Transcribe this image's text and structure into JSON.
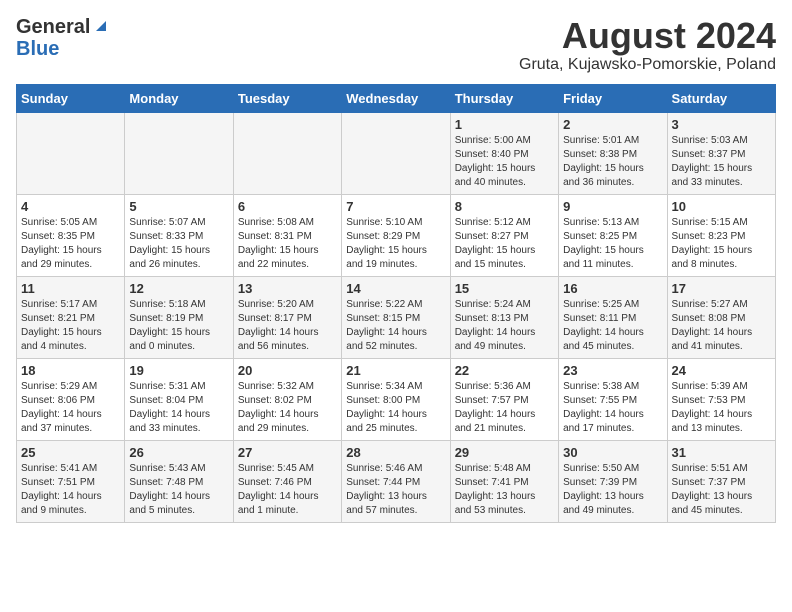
{
  "logo": {
    "line1": "General",
    "line2": "Blue"
  },
  "title": "August 2024",
  "subtitle": "Gruta, Kujawsko-Pomorskie, Poland",
  "headers": [
    "Sunday",
    "Monday",
    "Tuesday",
    "Wednesday",
    "Thursday",
    "Friday",
    "Saturday"
  ],
  "weeks": [
    [
      {
        "day": "",
        "info": ""
      },
      {
        "day": "",
        "info": ""
      },
      {
        "day": "",
        "info": ""
      },
      {
        "day": "",
        "info": ""
      },
      {
        "day": "1",
        "info": "Sunrise: 5:00 AM\nSunset: 8:40 PM\nDaylight: 15 hours\nand 40 minutes."
      },
      {
        "day": "2",
        "info": "Sunrise: 5:01 AM\nSunset: 8:38 PM\nDaylight: 15 hours\nand 36 minutes."
      },
      {
        "day": "3",
        "info": "Sunrise: 5:03 AM\nSunset: 8:37 PM\nDaylight: 15 hours\nand 33 minutes."
      }
    ],
    [
      {
        "day": "4",
        "info": "Sunrise: 5:05 AM\nSunset: 8:35 PM\nDaylight: 15 hours\nand 29 minutes."
      },
      {
        "day": "5",
        "info": "Sunrise: 5:07 AM\nSunset: 8:33 PM\nDaylight: 15 hours\nand 26 minutes."
      },
      {
        "day": "6",
        "info": "Sunrise: 5:08 AM\nSunset: 8:31 PM\nDaylight: 15 hours\nand 22 minutes."
      },
      {
        "day": "7",
        "info": "Sunrise: 5:10 AM\nSunset: 8:29 PM\nDaylight: 15 hours\nand 19 minutes."
      },
      {
        "day": "8",
        "info": "Sunrise: 5:12 AM\nSunset: 8:27 PM\nDaylight: 15 hours\nand 15 minutes."
      },
      {
        "day": "9",
        "info": "Sunrise: 5:13 AM\nSunset: 8:25 PM\nDaylight: 15 hours\nand 11 minutes."
      },
      {
        "day": "10",
        "info": "Sunrise: 5:15 AM\nSunset: 8:23 PM\nDaylight: 15 hours\nand 8 minutes."
      }
    ],
    [
      {
        "day": "11",
        "info": "Sunrise: 5:17 AM\nSunset: 8:21 PM\nDaylight: 15 hours\nand 4 minutes."
      },
      {
        "day": "12",
        "info": "Sunrise: 5:18 AM\nSunset: 8:19 PM\nDaylight: 15 hours\nand 0 minutes."
      },
      {
        "day": "13",
        "info": "Sunrise: 5:20 AM\nSunset: 8:17 PM\nDaylight: 14 hours\nand 56 minutes."
      },
      {
        "day": "14",
        "info": "Sunrise: 5:22 AM\nSunset: 8:15 PM\nDaylight: 14 hours\nand 52 minutes."
      },
      {
        "day": "15",
        "info": "Sunrise: 5:24 AM\nSunset: 8:13 PM\nDaylight: 14 hours\nand 49 minutes."
      },
      {
        "day": "16",
        "info": "Sunrise: 5:25 AM\nSunset: 8:11 PM\nDaylight: 14 hours\nand 45 minutes."
      },
      {
        "day": "17",
        "info": "Sunrise: 5:27 AM\nSunset: 8:08 PM\nDaylight: 14 hours\nand 41 minutes."
      }
    ],
    [
      {
        "day": "18",
        "info": "Sunrise: 5:29 AM\nSunset: 8:06 PM\nDaylight: 14 hours\nand 37 minutes."
      },
      {
        "day": "19",
        "info": "Sunrise: 5:31 AM\nSunset: 8:04 PM\nDaylight: 14 hours\nand 33 minutes."
      },
      {
        "day": "20",
        "info": "Sunrise: 5:32 AM\nSunset: 8:02 PM\nDaylight: 14 hours\nand 29 minutes."
      },
      {
        "day": "21",
        "info": "Sunrise: 5:34 AM\nSunset: 8:00 PM\nDaylight: 14 hours\nand 25 minutes."
      },
      {
        "day": "22",
        "info": "Sunrise: 5:36 AM\nSunset: 7:57 PM\nDaylight: 14 hours\nand 21 minutes."
      },
      {
        "day": "23",
        "info": "Sunrise: 5:38 AM\nSunset: 7:55 PM\nDaylight: 14 hours\nand 17 minutes."
      },
      {
        "day": "24",
        "info": "Sunrise: 5:39 AM\nSunset: 7:53 PM\nDaylight: 14 hours\nand 13 minutes."
      }
    ],
    [
      {
        "day": "25",
        "info": "Sunrise: 5:41 AM\nSunset: 7:51 PM\nDaylight: 14 hours\nand 9 minutes."
      },
      {
        "day": "26",
        "info": "Sunrise: 5:43 AM\nSunset: 7:48 PM\nDaylight: 14 hours\nand 5 minutes."
      },
      {
        "day": "27",
        "info": "Sunrise: 5:45 AM\nSunset: 7:46 PM\nDaylight: 14 hours\nand 1 minute."
      },
      {
        "day": "28",
        "info": "Sunrise: 5:46 AM\nSunset: 7:44 PM\nDaylight: 13 hours\nand 57 minutes."
      },
      {
        "day": "29",
        "info": "Sunrise: 5:48 AM\nSunset: 7:41 PM\nDaylight: 13 hours\nand 53 minutes."
      },
      {
        "day": "30",
        "info": "Sunrise: 5:50 AM\nSunset: 7:39 PM\nDaylight: 13 hours\nand 49 minutes."
      },
      {
        "day": "31",
        "info": "Sunrise: 5:51 AM\nSunset: 7:37 PM\nDaylight: 13 hours\nand 45 minutes."
      }
    ]
  ]
}
